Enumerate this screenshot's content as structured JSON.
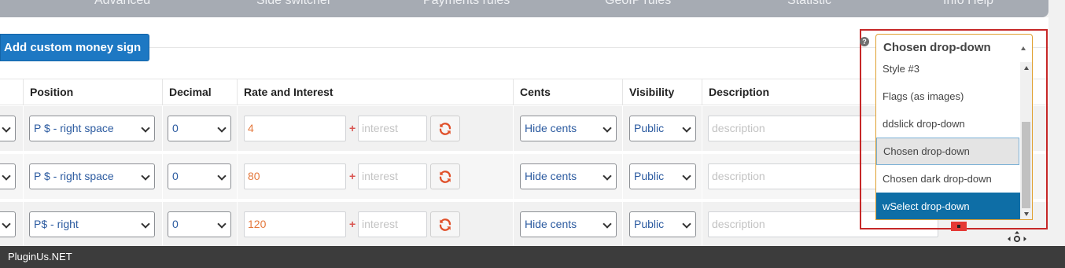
{
  "nav": {
    "tabs": [
      "Advanced",
      "Side switcher",
      "Payments rules",
      "GeoIP rules",
      "Statistic",
      "Info Help"
    ]
  },
  "toolbar": {
    "add_button_label": "Add custom money sign",
    "help_icon_glyph": "?"
  },
  "table": {
    "headers": {
      "position": "Position",
      "decimal": "Decimal",
      "rate": "Rate and Interest",
      "cents": "Cents",
      "visibility": "Visibility",
      "description": "Description"
    },
    "rows": [
      {
        "position": "P $ - right space",
        "decimal": "0",
        "rate": "4",
        "interest_placeholder": "interest",
        "cents": "Hide cents",
        "visibility": "Public",
        "description_placeholder": "description"
      },
      {
        "position": "P $ - right space",
        "decimal": "0",
        "rate": "80",
        "interest_placeholder": "interest",
        "cents": "Hide cents",
        "visibility": "Public",
        "description_placeholder": "description"
      },
      {
        "position": "P$ - right",
        "decimal": "0",
        "rate": "120",
        "interest_placeholder": "interest",
        "cents": "Hide cents",
        "visibility": "Public",
        "description_placeholder": "description"
      }
    ],
    "plus_sign": "+"
  },
  "dropdown": {
    "selected": "Chosen drop-down",
    "options": [
      "Style #3",
      "Flags (as images)",
      "ddslick drop-down",
      "Chosen drop-down",
      "Chosen dark drop-down",
      "wSelect drop-down"
    ],
    "hovered_option": "Chosen drop-down",
    "highlighted_option": "wSelect drop-down"
  },
  "footer": {
    "brand": "PluginUs.NET"
  },
  "colors": {
    "accent_blue": "#1d78c3",
    "highlight_red": "#c62828",
    "rate_value": "#e4783c",
    "dropdown_selected": "#0e6ea6"
  }
}
